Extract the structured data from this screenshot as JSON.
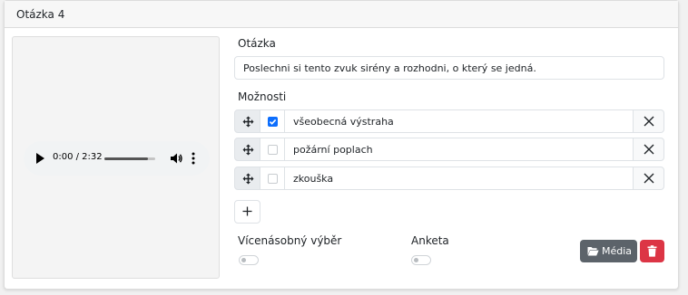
{
  "card": {
    "title": "Otázka 4"
  },
  "audio_player": {
    "time": "0:00 / 2:32",
    "progress_fraction": 0.85
  },
  "question": {
    "label": "Otázka",
    "value": "Poslechni si tento zvuk sirény a rozhodni, o který se jedná."
  },
  "options": {
    "label": "Možnosti",
    "items": [
      {
        "text": "všeobecná výstraha",
        "checked": true
      },
      {
        "text": "požární poplach",
        "checked": false
      },
      {
        "text": "zkouška",
        "checked": false
      }
    ]
  },
  "toggles": {
    "multiple_choice": {
      "label": "Vícenásobný výběr",
      "on": false
    },
    "survey": {
      "label": "Anketa",
      "on": false
    }
  },
  "buttons": {
    "media_label": "Média"
  },
  "colors": {
    "accent": "#0d6efd",
    "danger": "#dc3545",
    "secondary": "#5c636a"
  },
  "icons": {
    "drag": "move-icon",
    "remove": "close-icon",
    "add": "plus-icon",
    "media": "folder-open-icon",
    "delete": "trash-icon"
  }
}
